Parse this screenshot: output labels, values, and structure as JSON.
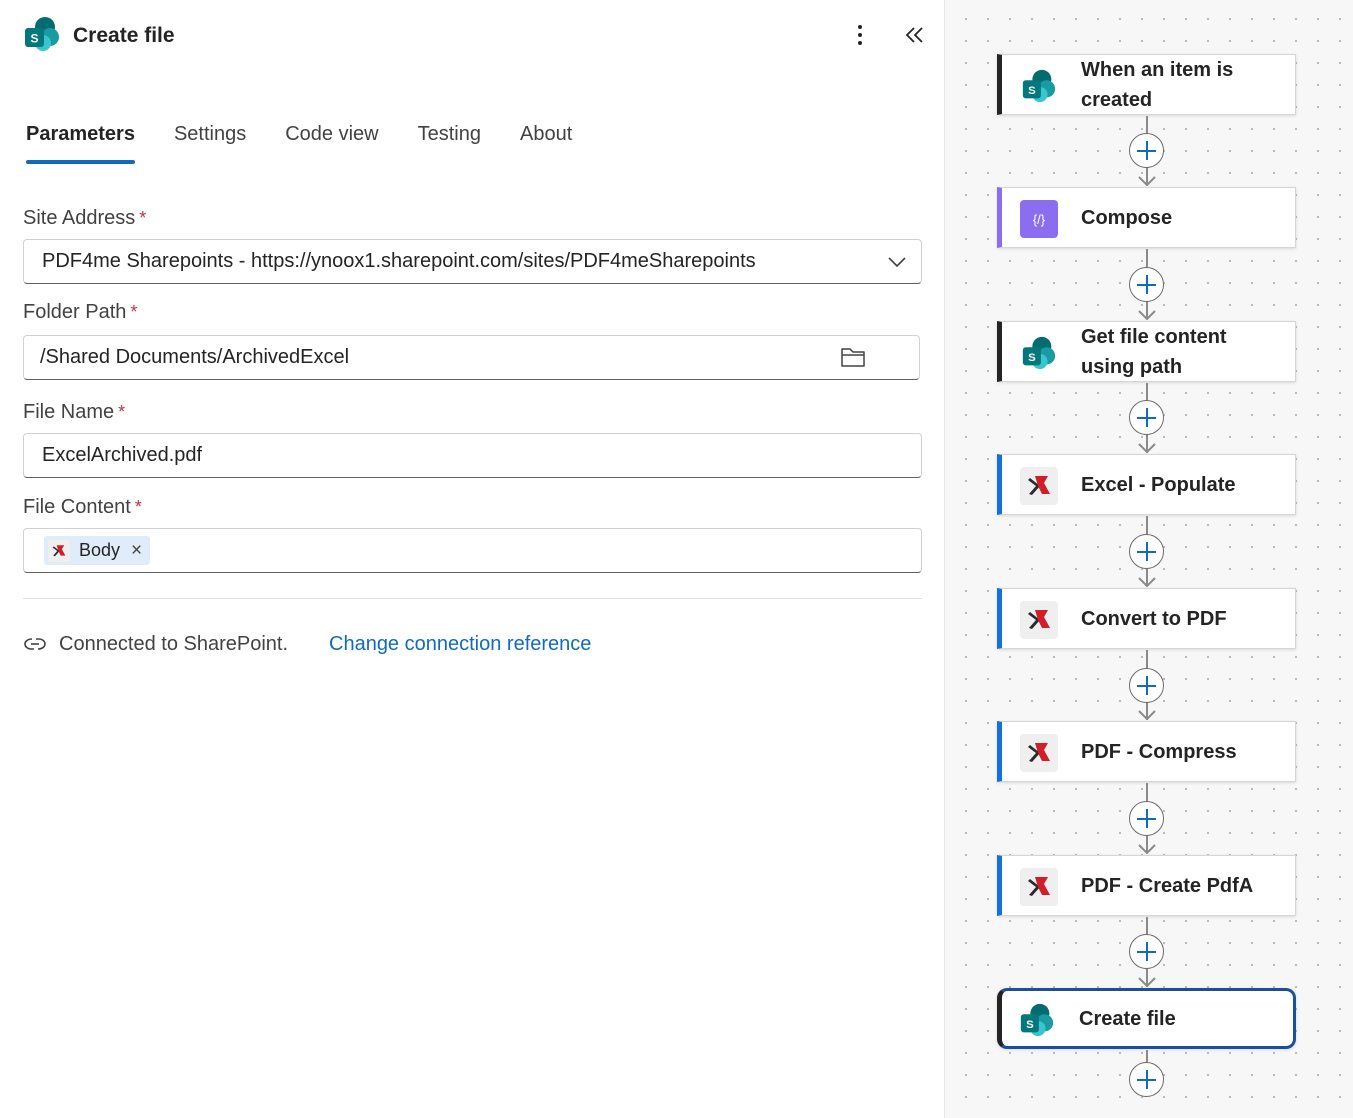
{
  "panel": {
    "title": "Create file",
    "tabs": [
      "Parameters",
      "Settings",
      "Code view",
      "Testing",
      "About"
    ],
    "active_tab": "Parameters"
  },
  "fields": {
    "site_address": {
      "label": "Site Address",
      "required": "*",
      "value": "PDF4me Sharepoints - https://ynoox1.sharepoint.com/sites/PDF4meSharepoints"
    },
    "folder_path": {
      "label": "Folder Path",
      "required": "*",
      "value": "/Shared Documents/ArchivedExcel"
    },
    "file_name": {
      "label": "File Name",
      "required": "*",
      "value": "ExcelArchived.pdf"
    },
    "file_content": {
      "label": "File Content",
      "required": "*",
      "token": "Body",
      "token_close": "×"
    }
  },
  "connection": {
    "status": "Connected to SharePoint.",
    "link": "Change connection reference"
  },
  "flow": {
    "steps": [
      {
        "label": "When an item is created",
        "icon": "sharepoint-icon"
      },
      {
        "label": "Compose",
        "icon": "compose-icon"
      },
      {
        "label": "Get file content using path",
        "icon": "sharepoint-icon"
      },
      {
        "label": "Excel - Populate",
        "icon": "pdf4me-icon"
      },
      {
        "label": "Convert to PDF",
        "icon": "pdf4me-icon"
      },
      {
        "label": "PDF - Compress",
        "icon": "pdf4me-icon"
      },
      {
        "label": "PDF - Create PdfA",
        "icon": "pdf4me-icon"
      },
      {
        "label": "Create file",
        "icon": "sharepoint-icon",
        "selected": true
      }
    ]
  },
  "colors": {
    "accent": "#0f6cbd",
    "required": "#c4314b",
    "compose": "#8b6ef0",
    "selected_border": "#1b4fa0"
  }
}
